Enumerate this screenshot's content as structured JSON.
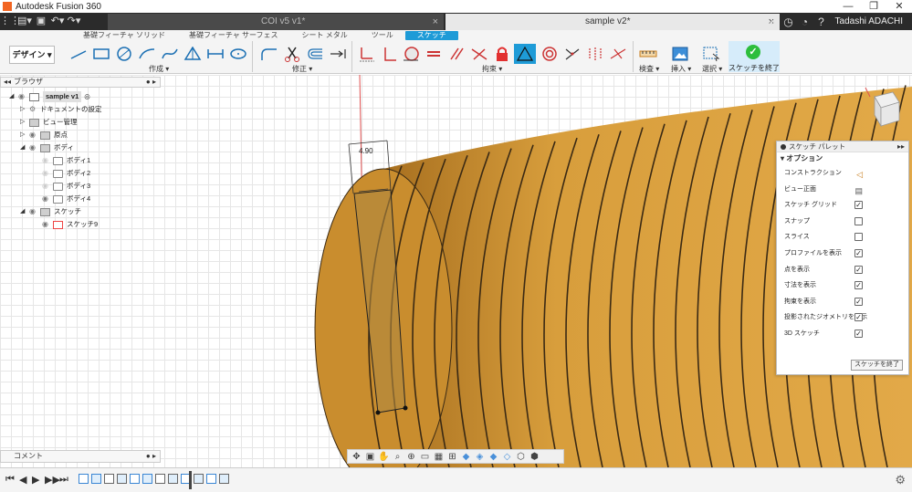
{
  "window": {
    "title": "Autodesk Fusion 360",
    "controls": [
      "—",
      "❐",
      "✕"
    ]
  },
  "tabs": {
    "items": [
      {
        "label": "COI v5 v1*",
        "active": false
      },
      {
        "label": "sample v2*",
        "active": true
      }
    ],
    "user": "Tadashi ADACHI"
  },
  "ribbon": {
    "workspace": "デザイン ▾",
    "tabs": [
      "基礎フィーチャ ソリッド",
      "基礎フィーチャ サーフェス",
      "シート メタル",
      "ツール",
      "スケッチ"
    ],
    "active_tab": "スケッチ",
    "groups": {
      "create": "作成 ▾",
      "modify": "修正 ▾",
      "constraints": "拘束 ▾",
      "inspect": "検査 ▾",
      "insert": "挿入 ▾",
      "select": "選択 ▾",
      "finish": "スケッチを終了 ▾"
    }
  },
  "browser": {
    "header": "ブラウザ",
    "items": [
      {
        "label": "sample v1",
        "level": 0
      },
      {
        "label": "ドキュメントの設定",
        "level": 1
      },
      {
        "label": "ビュー管理",
        "level": 1
      },
      {
        "label": "原点",
        "level": 1
      },
      {
        "label": "ボディ",
        "level": 1
      },
      {
        "label": "ボディ1",
        "level": 2
      },
      {
        "label": "ボディ2",
        "level": 2
      },
      {
        "label": "ボディ3",
        "level": 2
      },
      {
        "label": "ボディ4",
        "level": 2
      },
      {
        "label": "スケッチ",
        "level": 1
      },
      {
        "label": "スケッチ9",
        "level": 2
      }
    ]
  },
  "comment": {
    "label": "コメント"
  },
  "canvas": {
    "dimension": "4.90",
    "colors": {
      "body": "#d49a3a",
      "body_shade": "#a26a1c",
      "groove": "#3b2a14"
    }
  },
  "palette": {
    "title": "スケッチ パレット",
    "section": "オプション",
    "options": [
      {
        "label": "コンストラクション",
        "type": "tool"
      },
      {
        "label": "ビュー正面",
        "type": "tool"
      },
      {
        "label": "スケッチ グリッド",
        "checked": true
      },
      {
        "label": "スナップ",
        "checked": false
      },
      {
        "label": "スライス",
        "checked": false
      },
      {
        "label": "プロファイルを表示",
        "checked": true
      },
      {
        "label": "点を表示",
        "checked": true
      },
      {
        "label": "寸法を表示",
        "checked": true
      },
      {
        "label": "拘束を表示",
        "checked": true
      },
      {
        "label": "投影されたジオメトリを表示",
        "checked": true
      },
      {
        "label": "3D スケッチ",
        "checked": true
      }
    ],
    "finish_button": "スケッチを終了"
  }
}
